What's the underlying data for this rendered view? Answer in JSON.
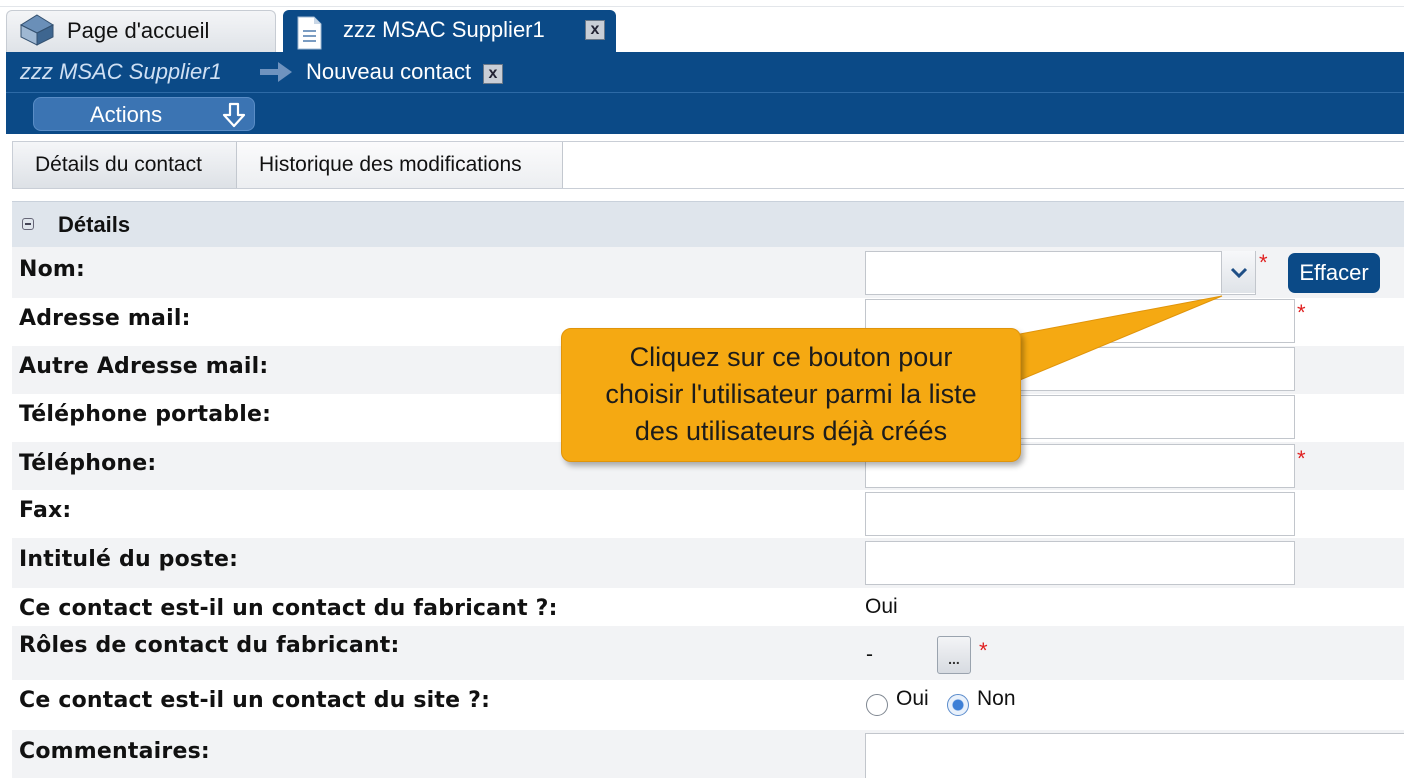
{
  "tabs": {
    "home_label": "Page d'accueil",
    "active_label": "zzz MSAC Supplier1",
    "close_label": "x"
  },
  "breadcrumb": {
    "parent": "zzz MSAC Supplier1",
    "current": "Nouveau contact",
    "close_label": "x"
  },
  "actions": {
    "label": "Actions"
  },
  "subtabs": {
    "details": "Détails du contact",
    "history": "Historique des modifications"
  },
  "section": {
    "title": "Détails"
  },
  "form": {
    "nom": {
      "label": "Nom:",
      "value": ""
    },
    "email": {
      "label": "Adresse mail:",
      "value": ""
    },
    "email2": {
      "label": "Autre Adresse mail:",
      "value": ""
    },
    "mobile": {
      "label": "Téléphone portable:",
      "value": ""
    },
    "phone": {
      "label": "Téléphone:",
      "value": ""
    },
    "fax": {
      "label": "Fax:",
      "value": ""
    },
    "job": {
      "label": "Intitulé du poste:",
      "value": ""
    },
    "manufacturer_q": {
      "label": "Ce contact est-il un contact du fabricant ?:",
      "value": "Oui"
    },
    "roles": {
      "label": "Rôles de contact du fabricant:",
      "value": "-",
      "button": "..."
    },
    "site_q": {
      "label": "Ce contact est-il un contact du site ?:",
      "options": [
        "Oui",
        "Non"
      ],
      "selected": "Non"
    },
    "comments": {
      "label": "Commentaires:",
      "value": ""
    },
    "required_mark": "*",
    "clear_button": "Effacer"
  },
  "callout": {
    "lines": [
      "Cliquez sur ce bouton pour",
      "choisir l'utilisateur parmi la liste",
      "des utilisateurs déjà créés"
    ]
  },
  "colors": {
    "brand_blue": "#0b4a87",
    "callout": "#f5a912",
    "required": "#e02020"
  }
}
